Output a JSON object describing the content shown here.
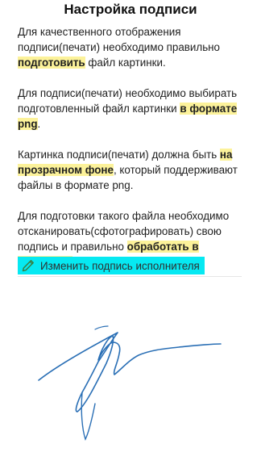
{
  "header": {
    "title": "Настройка подписи"
  },
  "paragraphs": [
    {
      "parts": [
        {
          "text": "Для качественного отображения подписи(печати) необходимо правильно ",
          "highlight": false
        },
        {
          "text": "подготовить",
          "highlight": true
        },
        {
          "text": " файл картинки.",
          "highlight": false
        }
      ]
    },
    {
      "parts": [
        {
          "text": "Для подписи(печати) необходимо выбирать подготовленный файл картинки ",
          "highlight": false
        },
        {
          "text": "в формате png",
          "highlight": true
        },
        {
          "text": ".",
          "highlight": false
        }
      ]
    },
    {
      "parts": [
        {
          "text": "Картинка подписи(печати) должна быть ",
          "highlight": false
        },
        {
          "text": "на прозрачном фоне",
          "highlight": true
        },
        {
          "text": ", который поддерживают файлы в формате png.",
          "highlight": false
        }
      ]
    },
    {
      "parts": [
        {
          "text": "Для подготовки такого файла необходимо отсканировать(сфотографировать) свою подпись и правильно ",
          "highlight": false
        },
        {
          "text": "обработать в редакторе",
          "highlight": true
        },
        {
          "text": ".",
          "highlight": false
        }
      ]
    }
  ],
  "edit_button": {
    "label": "Изменить подпись исполнителя",
    "icon": "pencil-icon",
    "color": "#06e9f2"
  },
  "signature": {
    "ink_color": "#2a6fb5"
  },
  "colors": {
    "highlight": "#fcf29a"
  }
}
